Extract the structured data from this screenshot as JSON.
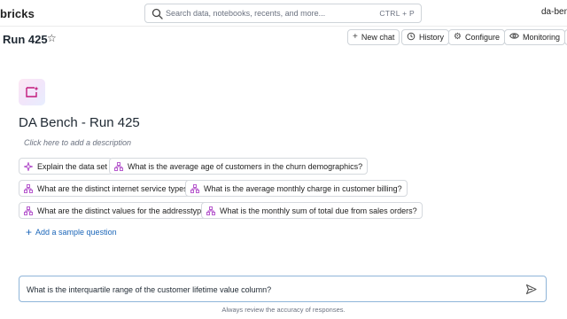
{
  "topbar": {
    "brand": "bricks",
    "search_placeholder": "Search data, notebooks, recents, and more...",
    "search_shortcut": "CTRL + P",
    "workspace": "da-ben"
  },
  "header": {
    "title": "Run 425",
    "buttons": {
      "new_chat": "New chat",
      "history": "History",
      "configure": "Configure",
      "monitoring": "Monitoring"
    }
  },
  "space": {
    "title": "DA Bench - Run 425",
    "description_placeholder": "Click here to add a description"
  },
  "sample_questions": [
    "Explain the data set",
    "What is the average age of customers in the churn demographics?",
    "What are the distinct internet service types?",
    "What is the average monthly charge in customer billing?",
    "What are the distinct values for the addresstype?",
    "What is the monthly sum of total due from sales orders?"
  ],
  "add_sample_question": "Add a sample question",
  "chat": {
    "input_value": "What is the interquartile range of the customer lifetime value column?",
    "disclaimer": "Always review the accuracy of responses."
  },
  "colors": {
    "accent_blue": "#1b66b9",
    "input_border": "#8fb5d9",
    "chip_icon_purple": "#b04ac9"
  }
}
